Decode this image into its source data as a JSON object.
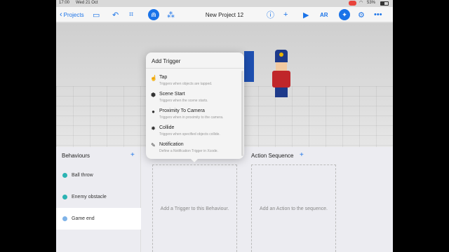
{
  "status": {
    "time": "17:00",
    "date": "Wed 21 Oct",
    "battery": "53%"
  },
  "toolbar": {
    "back_label": "Projects",
    "title": "New Project 12",
    "ar_label": "AR"
  },
  "popover": {
    "title": "Add Trigger",
    "items": [
      {
        "label": "Tap",
        "desc": "Triggers when objects are tapped."
      },
      {
        "label": "Scene Start",
        "desc": "Triggers when the scene starts."
      },
      {
        "label": "Proximity To Camera",
        "desc": "Triggers when in proximity to the camera."
      },
      {
        "label": "Collide",
        "desc": "Triggers when specified objects collide."
      },
      {
        "label": "Notification",
        "desc": "Define a Notification Trigger in Xcode."
      }
    ]
  },
  "behaviours": {
    "header": "Behaviours",
    "items": [
      {
        "label": "Ball throw"
      },
      {
        "label": "Enemy obstacle"
      },
      {
        "label": "Game end"
      }
    ]
  },
  "trigger_area": {
    "placeholder": "Add a Trigger to this Behaviour."
  },
  "action_sequence": {
    "header": "Action Sequence",
    "placeholder": "Add an Action to the sequence."
  }
}
